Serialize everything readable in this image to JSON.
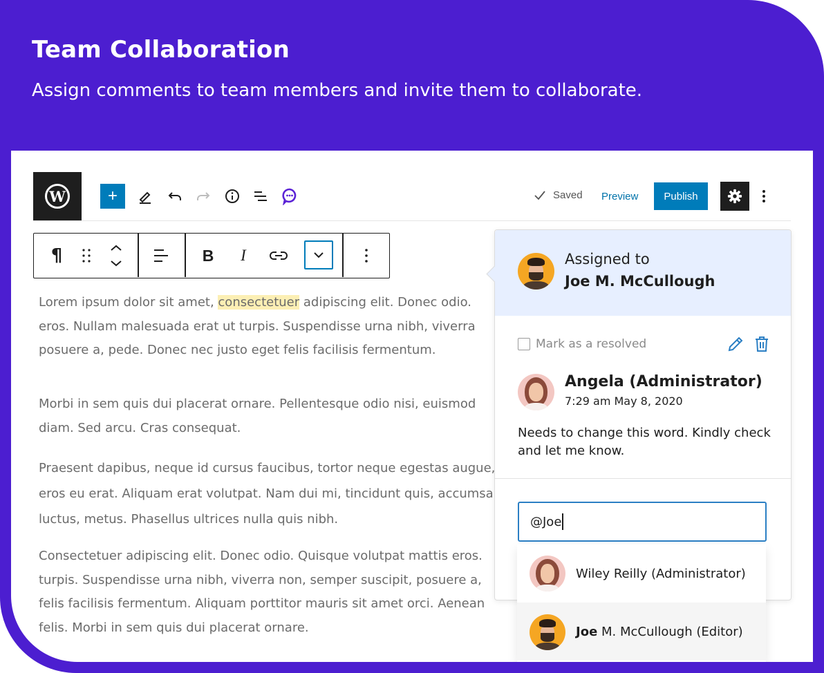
{
  "hero": {
    "title": "Team Collaboration",
    "subtitle": "Assign comments to team members and invite them to collaborate."
  },
  "toolbar": {
    "logo_letter": "W",
    "add_label": "+",
    "saved_label": "Saved",
    "preview_label": "Preview",
    "publish_label": "Publish"
  },
  "block_toolbar": {
    "paragraph_glyph": "¶",
    "bold_glyph": "B",
    "italic_glyph": "I"
  },
  "content": {
    "p1_before": "Lorem ipsum dolor sit amet, ",
    "p1_highlight": "consectetuer",
    "p1_after": " adipiscing elit. Donec odio.",
    "p1_line2": "eros. Nullam malesuada erat ut turpis. Suspendisse urna nibh, viverra",
    "p1_line3": "posuere a, pede. Donec nec justo eget felis facilisis fermentum.",
    "p2_line1": "Morbi in sem quis dui placerat ornare. Pellentesque odio nisi, euismod",
    "p2_line2": "diam. Sed arcu. Cras consequat.",
    "p3_line1": "Praesent dapibus, neque id cursus faucibus, tortor neque egestas augue,",
    "p3_line2": "eros eu erat. Aliquam erat volutpat. Nam dui mi, tincidunt quis, accumsan",
    "p3_line3": "luctus, metus. Phasellus ultrices nulla quis nibh.",
    "p4_line1": "Consectetuer adipiscing elit. Donec odio. Quisque volutpat mattis eros.",
    "p4_line2": "turpis. Suspendisse urna nibh, viverra non, semper suscipit, posuere a,",
    "p4_line3": "felis facilisis fermentum. Aliquam porttitor mauris sit amet orci. Aenean",
    "p4_line4": "felis. Morbi in sem quis dui placerat ornare."
  },
  "comment_panel": {
    "assigned_label": "Assigned to",
    "assigned_name": "Joe M. McCullough",
    "resolve_label": "Mark as a resolved",
    "author": "Angela (Administrator)",
    "timestamp": "7:29 am May 8, 2020",
    "text": "Needs to change this word. Kindly check and let me know.",
    "input_value": "@Joe"
  },
  "mention_dropdown": {
    "items": [
      {
        "name": "Wiley Reilly (Administrator)"
      },
      {
        "name_match": "Joe",
        "name_rest": " M. McCullough (Editor)"
      }
    ]
  },
  "colors": {
    "brand_purple": "#4c1ed0",
    "wp_blue": "#007cba",
    "highlight": "#fcefb4",
    "assigned_bg": "#e7efff"
  }
}
